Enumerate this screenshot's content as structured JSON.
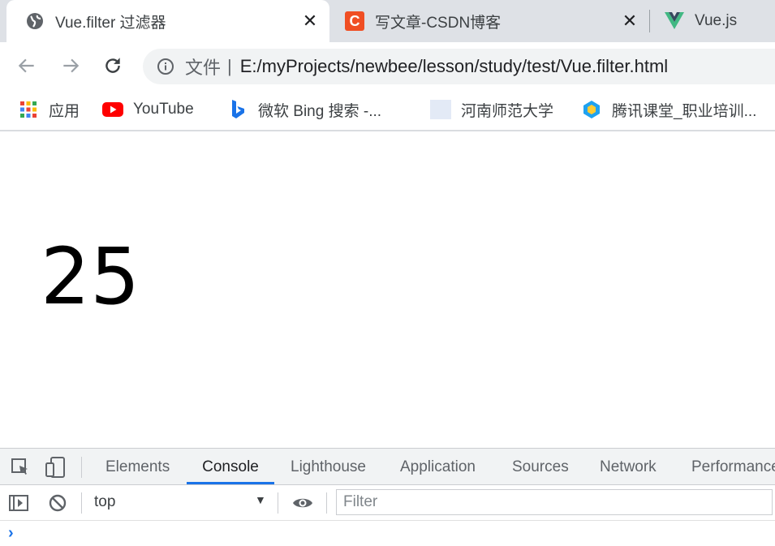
{
  "browser": {
    "tabs": [
      {
        "title": "Vue.filter 过滤器",
        "favicon": "globe-icon",
        "active": true
      },
      {
        "title": "写文章-CSDN博客",
        "favicon": "csdn-icon",
        "favicon_letter": "C",
        "active": false
      },
      {
        "title": "Vue.js",
        "favicon": "vue-icon",
        "active": false
      }
    ],
    "close_glyph": "✕",
    "omnibox": {
      "scheme_label": "文件",
      "url": "E:/myProjects/newbee/lesson/study/test/Vue.filter.html"
    },
    "bookmarks": [
      {
        "label": "应用",
        "icon": "apps-grid-icon"
      },
      {
        "label": "YouTube",
        "icon": "youtube-icon"
      },
      {
        "label": "微软 Bing 搜索 -...",
        "icon": "bing-icon"
      },
      {
        "label": "河南师范大学",
        "icon": "blank-page-icon"
      },
      {
        "label": "腾讯课堂_职业培训...",
        "icon": "tencent-classroom-icon"
      }
    ]
  },
  "page": {
    "content": "25"
  },
  "devtools": {
    "tabs": [
      "Elements",
      "Console",
      "Lighthouse",
      "Application",
      "Sources",
      "Network",
      "Performance"
    ],
    "active_tab": "Console",
    "context": "top",
    "filter_placeholder": "Filter",
    "prompt_glyph": "›"
  },
  "colors": {
    "tabstrip_bg": "#dee1e6",
    "accent": "#1a73e8",
    "csdn_red": "#f04e23",
    "youtube_red": "#ff0000",
    "vue_green": "#41b883",
    "vue_dark": "#35495e"
  }
}
